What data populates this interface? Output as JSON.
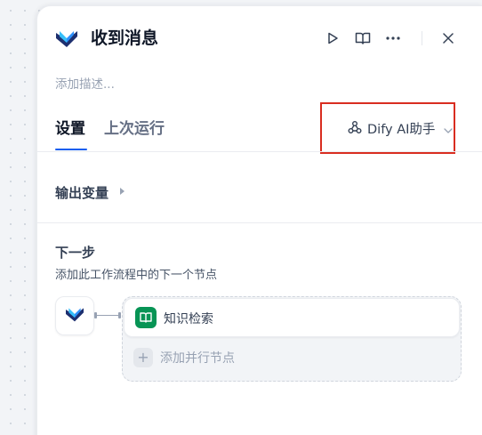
{
  "node": {
    "title": "收到消息",
    "description_placeholder": "添加描述...",
    "icon": "dify-logo-icon"
  },
  "header_actions": {
    "run_icon": "play-icon",
    "docs_icon": "book-open-icon",
    "more_icon": "more-horizontal-icon",
    "close_icon": "close-icon"
  },
  "tabs": [
    {
      "label": "设置",
      "active": true
    },
    {
      "label": "上次运行",
      "active": false
    }
  ],
  "model": {
    "label": "Dify AI助手",
    "icon": "webhook-icon",
    "highlight_color": "#d92d20"
  },
  "output_vars": {
    "title": "输出变量"
  },
  "next_step": {
    "title": "下一步",
    "subtitle": "添加此工作流程中的下一个节点",
    "next_node": {
      "label": "知识检索",
      "icon": "book-icon",
      "icon_color": "#079455"
    },
    "add_parallel_label": "添加并行节点"
  },
  "colors": {
    "accent": "#155eef",
    "brand_dark": "#1d2f6f",
    "brand_teal": "#2e90fa"
  }
}
